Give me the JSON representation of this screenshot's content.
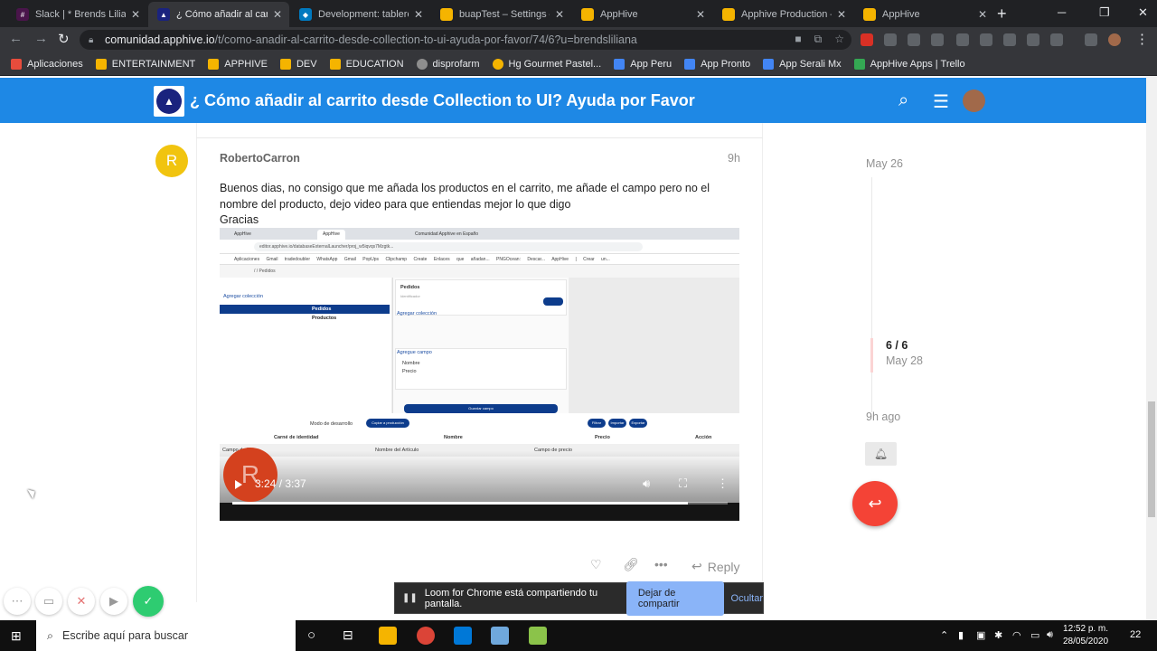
{
  "browser": {
    "tabs": [
      {
        "title": "Slack | * Brends Liliana |",
        "favicon_color": "#4a154b",
        "active": false
      },
      {
        "title": "¿ Cómo añadir al carrit",
        "favicon_color": "#1a237e",
        "active": true
      },
      {
        "title": "Development: tablero",
        "favicon_color": "#0079bf",
        "active": false
      },
      {
        "title": "buapTest – Settings – ",
        "favicon_color": "#f5b400",
        "active": false
      },
      {
        "title": "AppHive",
        "favicon_color": "#f5b400",
        "active": false
      },
      {
        "title": "Apphive Production – ",
        "favicon_color": "#f5b400",
        "active": false
      },
      {
        "title": "AppHive",
        "favicon_color": "#f5b400",
        "active": false
      }
    ],
    "url_host": "comunidad.apphive.io",
    "url_path": "/t/como-anadir-al-carrito-desde-collection-to-ui-ayuda-por-favor/74/6?u=brendsliliana",
    "bookmarks": [
      {
        "label": "Aplicaciones",
        "color": "#e74c3c"
      },
      {
        "label": "ENTERTAINMENT",
        "color": "#f5b400"
      },
      {
        "label": "APPHIVE",
        "color": "#f5b400"
      },
      {
        "label": "DEV",
        "color": "#f5b400"
      },
      {
        "label": "EDUCATION",
        "color": "#f5b400"
      },
      {
        "label": "disprofarm",
        "color": "#8e8e8e"
      },
      {
        "label": "Hg Gourmet Pastel...",
        "color": "#f5b400"
      },
      {
        "label": "App Peru",
        "color": "#4285f4"
      },
      {
        "label": "App Pronto",
        "color": "#4285f4"
      },
      {
        "label": "App Serali Mx",
        "color": "#4285f4"
      },
      {
        "label": "AppHive Apps | Trello",
        "color": "#34a853"
      }
    ]
  },
  "header": {
    "title": "¿ Cómo añadir al carrito desde Collection to UI? Ayuda por Favor",
    "brand_color": "#1e88e5"
  },
  "post": {
    "avatar_letter": "R",
    "username": "RobertoCarron",
    "age": "9h",
    "body_lines": [
      "Buenos dias, no consigo que me añada los productos en el carrito, me añade el campo pero no el",
      "nombre del producto, dejo video para que entiendas mejor lo que digo",
      "Gracias"
    ],
    "video": {
      "tabs": [
        "AppHive",
        "AppHive",
        "Comunidad Apphive en Españo"
      ],
      "url": "editor.apphive.io/databaseExternalLauncher/proj_w5iqvqs7Mzgtk...",
      "bookmarks": "Aplicaciones Gmail tradedoubler WhatsApp Gmail PopUps Clipchamp Create Enlaces que añadan... PNGOcean: Descar... AppHive | Crear un...",
      "crumb": "/ / Pedidos",
      "left_title": "Agregar colección",
      "left_selected": "Pedidos",
      "left_item": "Productos",
      "mid_title": "Pedidos",
      "mid_sub": "Identificador",
      "mid_add_collection": "Agregar colección",
      "mid_add_field": "Agregue campo",
      "mid_fields": [
        "Nombre",
        "Precio"
      ],
      "mid_save": "Guardar campo",
      "toolbar_label": "Modo de desarrollo",
      "toolbar_btn": "Copiar a producción",
      "toolbar_pills": [
        "Filtrar",
        "Importar",
        "Exportar"
      ],
      "table_headers": [
        "Carné de identidad",
        "Nombre",
        "Precio",
        "Acción"
      ],
      "table_row": [
        "Campo de fil",
        "Nombre del Artículo",
        "Campo de precio"
      ],
      "time": "3:24 / 3:37",
      "progress": 0.92
    },
    "actions": {
      "reply_label": "Reply"
    }
  },
  "timeline": {
    "start": "May 26",
    "count": "6 / 6",
    "date": "May 28",
    "end": "9h ago"
  },
  "sharebar": {
    "message": "Loom for Chrome está compartiendo tu pantalla.",
    "stop_label": "Dejar de compartir",
    "hide_label": "Ocultar"
  },
  "taskbar": {
    "search_placeholder": "Escribe aquí para buscar",
    "time": "12:52 p. m.",
    "date": "28/05/2020",
    "notifications": "22"
  }
}
